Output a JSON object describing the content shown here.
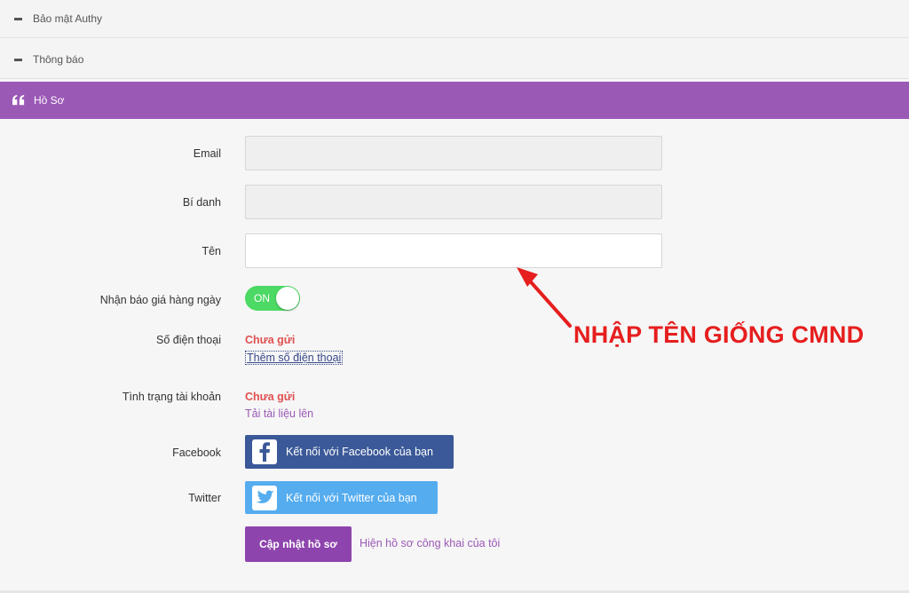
{
  "accordion": {
    "sections": [
      {
        "label": "Bảo mật Authy"
      },
      {
        "label": "Thông báo"
      }
    ],
    "active": {
      "label": "Hồ Sơ"
    }
  },
  "form": {
    "email": {
      "label": "Email",
      "value": ""
    },
    "alias": {
      "label": "Bí danh",
      "value": ""
    },
    "name": {
      "label": "Tên",
      "value": ""
    },
    "daily_quote": {
      "label": "Nhận báo giá hàng ngày",
      "state": "ON"
    },
    "phone": {
      "label": "Số điện thoại",
      "status": "Chưa gửi",
      "link": "Thêm số điện thoại"
    },
    "account_status": {
      "label": "Tình trạng tài khoản",
      "status": "Chưa gửi",
      "link": "Tải tài liệu lên"
    },
    "facebook": {
      "label": "Facebook",
      "button": "Kết nối với Facebook của bạn"
    },
    "twitter": {
      "label": "Twitter",
      "button": "Kết nối với Twitter của bạn"
    },
    "submit": {
      "label": "Cập nhật hồ sơ"
    },
    "public_profile": {
      "label": "Hiện hồ sơ công khai của tôi"
    }
  },
  "annotation": {
    "text": "NHẬP TÊN GIỐNG CMND"
  },
  "colors": {
    "accent": "#9b59b6",
    "toggle_on": "#4cd964",
    "facebook": "#3b5998",
    "twitter": "#55acee",
    "annotation": "#e61e1e"
  },
  "icons": {
    "quote": "quote-left-icon",
    "minus": "minus-icon",
    "facebook": "facebook-icon",
    "twitter": "twitter-icon"
  }
}
